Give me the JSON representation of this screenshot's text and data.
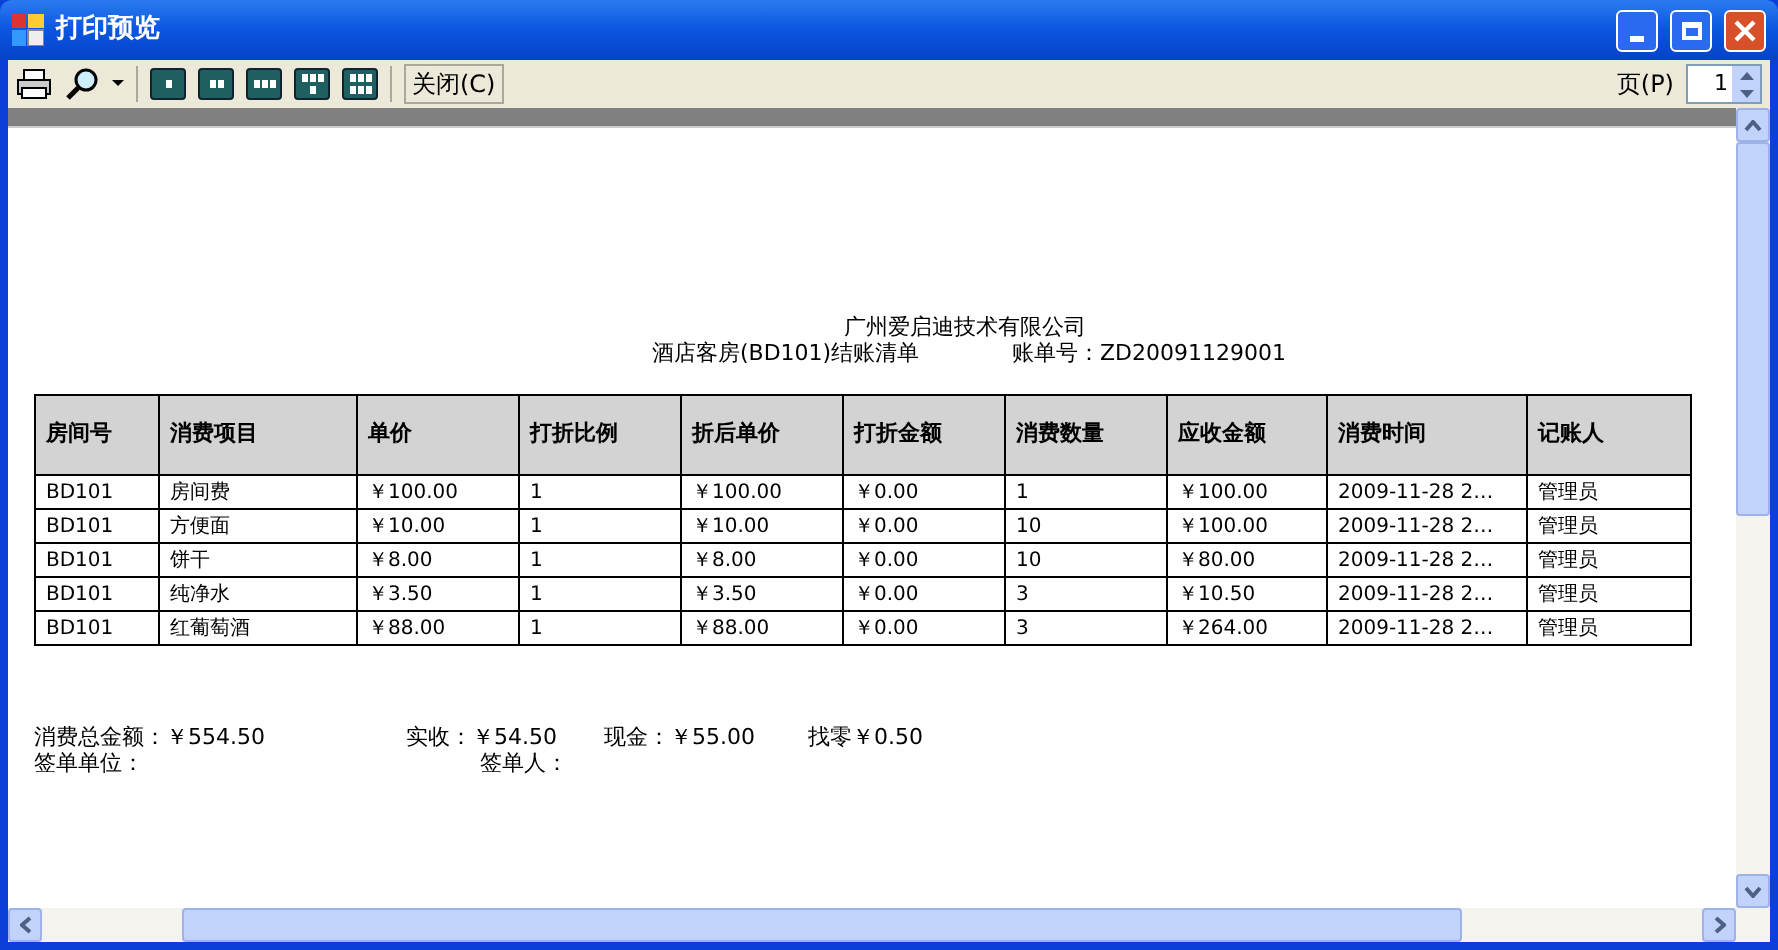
{
  "window": {
    "title": "打印预览"
  },
  "toolbar": {
    "close_button": "关闭(C)",
    "page_label": "页(P)",
    "page_value": "1"
  },
  "report": {
    "company": "广州爱启迪技术有限公司",
    "title": "酒店客房(BD101)结账清单",
    "bill_no": "账单号：ZD20091129001",
    "table": {
      "columns": [
        "房间号",
        "消费项目",
        "单价",
        "打折比例",
        "折后单价",
        "打折金额",
        "消费数量",
        "应收金额",
        "消费时间",
        "记账人"
      ],
      "rows": [
        [
          "BD101",
          "房间费",
          "￥100.00",
          "1",
          "￥100.00",
          "￥0.00",
          "1",
          "￥100.00",
          "2009-11-28  2…",
          "管理员"
        ],
        [
          "BD101",
          "方便面",
          "￥10.00",
          "1",
          "￥10.00",
          "￥0.00",
          "10",
          "￥100.00",
          "2009-11-28  2…",
          "管理员"
        ],
        [
          "BD101",
          "饼干",
          "￥8.00",
          "1",
          "￥8.00",
          "￥0.00",
          "10",
          "￥80.00",
          "2009-11-28  2…",
          "管理员"
        ],
        [
          "BD101",
          "纯净水",
          "￥3.50",
          "1",
          "￥3.50",
          "￥0.00",
          "3",
          "￥10.50",
          "2009-11-28  2…",
          "管理员"
        ],
        [
          "BD101",
          "红葡萄酒",
          "￥88.00",
          "1",
          "￥88.00",
          "￥0.00",
          "3",
          "￥264.00",
          "2009-11-28  2…",
          "管理员"
        ]
      ]
    },
    "summary": [
      "消费总金额：￥554.50",
      "实收：￥54.50",
      "现金：￥55.00",
      "找零￥0.50"
    ],
    "signatures": [
      "签单单位：",
      "签单人："
    ]
  }
}
